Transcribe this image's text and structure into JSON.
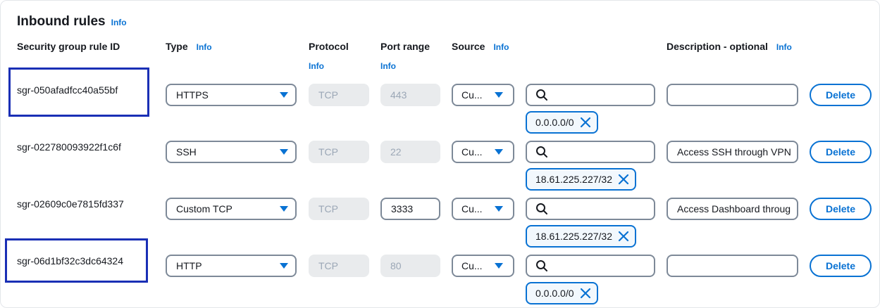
{
  "section": {
    "title": "Inbound rules",
    "info": "Info"
  },
  "columns": {
    "rule_id": "Security group rule ID",
    "type": "Type",
    "type_info": "Info",
    "protocol": "Protocol",
    "protocol_info": "Info",
    "port_range": "Port range",
    "port_range_info": "Info",
    "source": "Source",
    "source_info": "Info",
    "description": "Description - optional",
    "description_info": "Info"
  },
  "rules": [
    {
      "id": "sgr-050afadfcc40a55bf",
      "type": "HTTPS",
      "protocol": "TCP",
      "port": "443",
      "port_editable": false,
      "source_type": "Cu...",
      "search_value": "",
      "cidr": "0.0.0.0/0",
      "description": "",
      "delete": "Delete",
      "highlighted": true
    },
    {
      "id": "sgr-022780093922f1c6f",
      "type": "SSH",
      "protocol": "TCP",
      "port": "22",
      "port_editable": false,
      "source_type": "Cu...",
      "search_value": "",
      "cidr": "18.61.225.227/32",
      "description": "Access SSH through VPN",
      "delete": "Delete",
      "highlighted": false
    },
    {
      "id": "sgr-02609c0e7815fd337",
      "type": "Custom TCP",
      "protocol": "TCP",
      "port": "3333",
      "port_editable": true,
      "source_type": "Cu...",
      "search_value": "",
      "cidr": "18.61.225.227/32",
      "description": "Access Dashboard throug",
      "delete": "Delete",
      "highlighted": false
    },
    {
      "id": "sgr-06d1bf32c3dc64324",
      "type": "HTTP",
      "protocol": "TCP",
      "port": "80",
      "port_editable": false,
      "source_type": "Cu...",
      "search_value": "",
      "cidr": "0.0.0.0/0",
      "description": "",
      "delete": "Delete",
      "highlighted": true
    }
  ],
  "colors": {
    "accent": "#0972d3",
    "highlight_box": "#1a2fb5",
    "disabled_bg": "#e9ebed"
  },
  "icons": {
    "dropdown": "caret-down-icon",
    "search": "search-icon",
    "remove_token": "close-icon"
  }
}
